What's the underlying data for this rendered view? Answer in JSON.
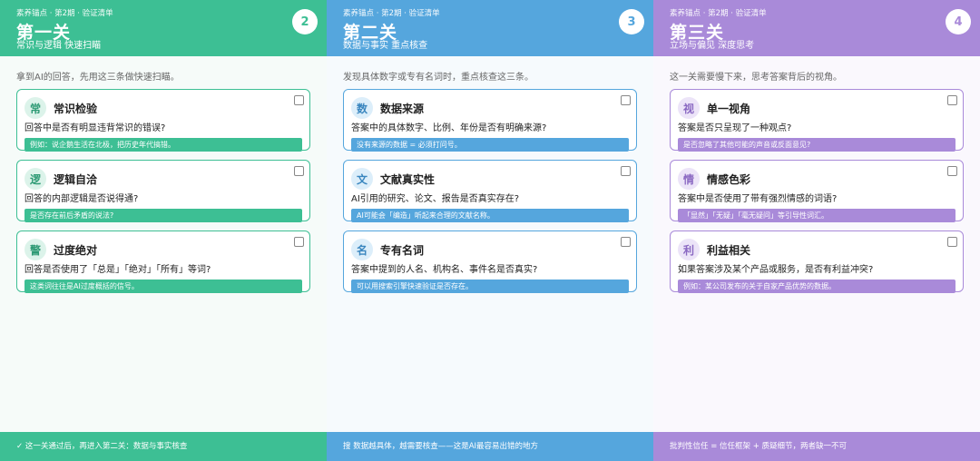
{
  "theme_colors": {
    "green": "#3dbf94",
    "blue": "#55a6dd",
    "purple": "#a98ad9"
  },
  "panels": [
    {
      "crumb": "素养锚点 · 第2期 · 验证清单",
      "title": "第一关",
      "subtitle": "常识与逻辑  快速扫瞄",
      "number": "2",
      "intro": "拿到AI的回答，先用这三条做快速扫瞄。",
      "cards": [
        {
          "glyph": "常",
          "title": "常识检验",
          "question": "回答中是否有明显违背常识的错误?",
          "note": "例如：说企鹅生活在北极，把历史年代搞错。"
        },
        {
          "glyph": "逻",
          "title": "逻辑自洽",
          "question": "回答的内部逻辑是否说得通?",
          "note": "是否存在前后矛盾的说法?"
        },
        {
          "glyph": "警",
          "title": "过度绝对",
          "question": "回答是否使用了「总是」「绝对」「所有」等词?",
          "note": "这类词往往是AI过度概括的信号。"
        }
      ],
      "footer": "✓ 这一关通过后，再进入第二关：数据与事实核查"
    },
    {
      "crumb": "素养锚点 · 第2期 · 验证清单",
      "title": "第二关",
      "subtitle": "数据与事实  重点核查",
      "number": "3",
      "intro": "发现具体数字或专有名词时，重点核查这三条。",
      "cards": [
        {
          "glyph": "数",
          "title": "数据来源",
          "question": "答案中的具体数字、比例、年份是否有明确来源?",
          "note": "没有来源的数据 = 必须打问号。"
        },
        {
          "glyph": "文",
          "title": "文献真实性",
          "question": "AI引用的研究、论文、报告是否真实存在?",
          "note": "AI可能会「编造」听起来合理的文献名称。"
        },
        {
          "glyph": "名",
          "title": "专有名词",
          "question": "答案中提到的人名、机构名、事件名是否真实?",
          "note": "可以用搜索引擎快速验证是否存在。"
        }
      ],
      "footer": "搜 数据越具体，越需要核查——这是AI最容易出错的地方"
    },
    {
      "crumb": "素养锚点 · 第2期 · 验证清单",
      "title": "第三关",
      "subtitle": "立场与偏见  深度思考",
      "number": "4",
      "intro": "这一关需要慢下来，思考答案背后的视角。",
      "cards": [
        {
          "glyph": "视",
          "title": "单一视角",
          "question": "答案是否只呈现了一种观点?",
          "note": "是否忽略了其他可能的声音或反面意见?"
        },
        {
          "glyph": "情",
          "title": "情感色彩",
          "question": "答案中是否使用了带有强烈情感的词语?",
          "note": "「显然」「无疑」「毫无疑问」等引导性词汇。"
        },
        {
          "glyph": "利",
          "title": "利益相关",
          "question": "如果答案涉及某个产品或服务，是否有利益冲突?",
          "note": "例如：某公司发布的关于自家产品优势的数据。"
        }
      ],
      "footer": "批判性信任 = 信任框架 + 质疑细节，两者缺一不可"
    }
  ]
}
